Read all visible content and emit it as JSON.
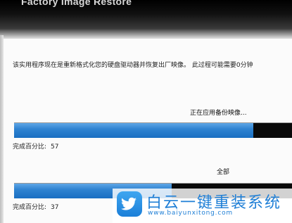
{
  "window": {
    "title": "Factory Image Restore"
  },
  "main": {
    "description": "该实用程序现在是重新格式化您的硬盘驱动器并恢复出厂映像。 此过程可能需要0分钟",
    "steps": [
      {
        "label": "正在应用备份映像...",
        "percent_label": "完成百分比:",
        "percent": "57",
        "progress": 0.85
      },
      {
        "label": "全部",
        "percent_label": "完成百分比:",
        "percent": "37",
        "progress": 0.56
      }
    ]
  },
  "watermark": {
    "brand": "白云一键重装系统",
    "url": "www.baiyunxitong.com",
    "logo": "twitter-bird-icon"
  },
  "colors": {
    "titlebar": "#000000",
    "progress_fill": "#2f83d1",
    "progress_track": "#0a0a0a",
    "watermark": "#1f7fd6"
  }
}
